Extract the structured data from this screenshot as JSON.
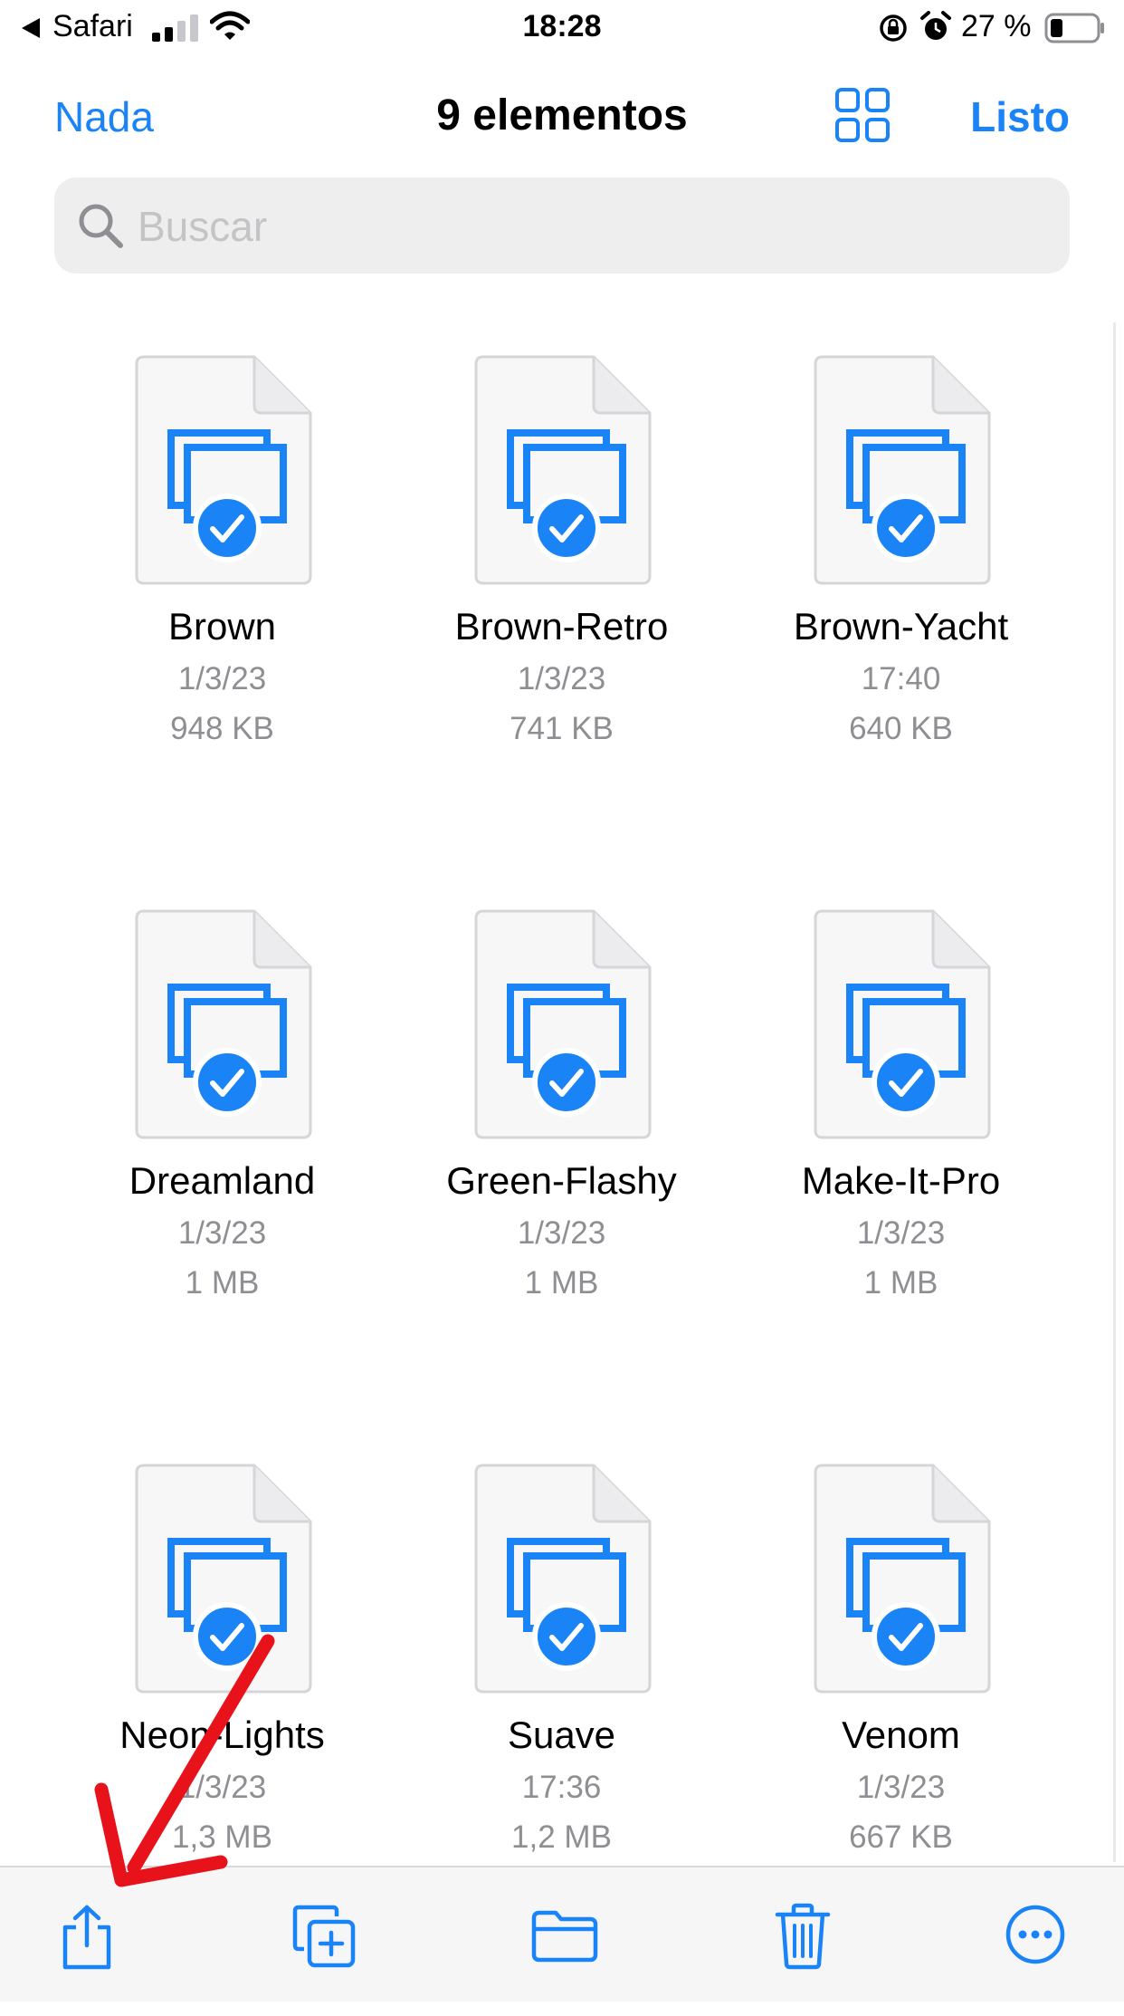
{
  "status_bar": {
    "back_app": "Safari",
    "time": "18:28",
    "battery_percent": "27 %",
    "battery_level": 0.27,
    "icons": [
      "back-arrow-icon",
      "cellular-signal-icon",
      "wifi-icon",
      "rotation-lock-icon",
      "alarm-icon",
      "battery-icon"
    ]
  },
  "nav": {
    "left_label": "Nada",
    "title": "9 elementos",
    "right_label": "Listo",
    "grid_icon": "grid-view-icon"
  },
  "search": {
    "placeholder": "Buscar",
    "value": ""
  },
  "colors": {
    "accent": "#1a84f6",
    "secondary_text": "#8e8e93",
    "annotation": "#e8121a"
  },
  "files": [
    {
      "name": "Brown",
      "date": "1/3/23",
      "size": "948 KB",
      "selected": true
    },
    {
      "name": "Brown-Retro",
      "date": "1/3/23",
      "size": "741 KB",
      "selected": true
    },
    {
      "name": "Brown-Yacht",
      "date": "17:40",
      "size": "640 KB",
      "selected": true
    },
    {
      "name": "Dreamland",
      "date": "1/3/23",
      "size": "1 MB",
      "selected": true
    },
    {
      "name": "Green-Flashy",
      "date": "1/3/23",
      "size": "1 MB",
      "selected": true
    },
    {
      "name": "Make-It-Pro",
      "date": "1/3/23",
      "size": "1 MB",
      "selected": true
    },
    {
      "name": "Neon-Lights",
      "date": "1/3/23",
      "size": "1,3 MB",
      "selected": true
    },
    {
      "name": "Suave",
      "date": "17:36",
      "size": "1,2 MB",
      "selected": true
    },
    {
      "name": "Venom",
      "date": "1/3/23",
      "size": "667 KB",
      "selected": true
    }
  ],
  "toolbar": {
    "items": [
      "share-icon",
      "duplicate-icon",
      "folder-icon",
      "trash-icon",
      "more-icon"
    ]
  }
}
